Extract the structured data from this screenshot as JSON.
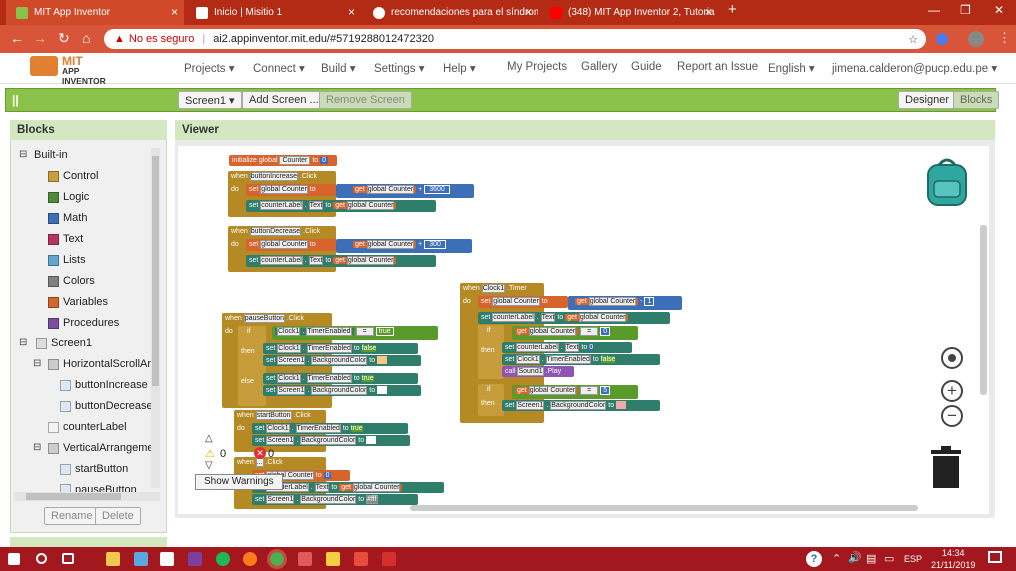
{
  "browser": {
    "tabs": [
      {
        "title": "MIT App Inventor",
        "active": true
      },
      {
        "title": "Inicio | Misitio 1",
        "active": false
      },
      {
        "title": "recomendaciones para el síndrom",
        "active": false
      },
      {
        "title": "(348) MIT App Inventor 2, Tutoria",
        "active": false
      }
    ],
    "new_tab": "+",
    "security": "No es seguro",
    "url": "ai2.appinventor.mit.edu/#5719288012472320"
  },
  "app": {
    "logo_line1": "MIT",
    "logo_line2": "APP INVENTOR",
    "menu": [
      "Projects ▾",
      "Connect ▾",
      "Build ▾",
      "Settings ▾",
      "Help ▾",
      "My Projects",
      "Gallery",
      "Guide",
      "Report an Issue",
      "English ▾",
      "jimena.calderon@pucp.edu.pe ▾"
    ],
    "toolbar": {
      "screen_select": "Screen1 ▾",
      "add_screen": "Add Screen ...",
      "remove_screen": "Remove Screen",
      "designer": "Designer",
      "blocks": "Blocks"
    }
  },
  "blocks_panel": {
    "title": "Blocks",
    "builtin": "Built-in",
    "categories": [
      {
        "name": "Control",
        "color": "#c8a040"
      },
      {
        "name": "Logic",
        "color": "#4f8a3a"
      },
      {
        "name": "Math",
        "color": "#3d6fb8"
      },
      {
        "name": "Text",
        "color": "#b5355d"
      },
      {
        "name": "Lists",
        "color": "#60a8d0"
      },
      {
        "name": "Colors",
        "color": "#808080"
      },
      {
        "name": "Variables",
        "color": "#d7642c"
      },
      {
        "name": "Procedures",
        "color": "#7a4fa0"
      }
    ],
    "screen": "Screen1",
    "components": [
      "HorizontalScrollArr",
      "buttonIncrease",
      "buttonDecrease",
      "counterLabel",
      "VerticalArrangemer",
      "startButton",
      "pauseButton"
    ],
    "rename": "Rename",
    "delete": "Delete"
  },
  "viewer": {
    "title": "Viewer",
    "warnings_count": "0",
    "errors_count": "0",
    "show_warnings": "Show Warnings"
  },
  "blocks": {
    "init": "initialize global",
    "counter_var": "Counter",
    "to": "to",
    "zero": "0",
    "when": "when",
    "do": "do",
    "set": "set",
    "get": "get",
    "global_counter": "global Counter",
    "click": "Click",
    "timer": "Timer",
    "buttonIncrease": "buttonIncrease",
    "buttonDecrease": "buttonDecrease",
    "pauseButton": "pauseButton",
    "startButton": "startButton",
    "clock1": "Clock1",
    "counterLabel": "counterLabel",
    "screen1": "Screen1",
    "text_prop": "Text",
    "bg_prop": "BackgroundColor",
    "timer_enabled": "TimerEnabled",
    "val_3600": "3600",
    "val_300": "300",
    "val_1": "1",
    "val_5": "5",
    "true": "true",
    "false": "false",
    "if": "if",
    "then": "then",
    "else": "else",
    "call": "call",
    "sound1": "Sound1",
    "play": "Play",
    "plus": "+",
    "minus": "-",
    "eq": "=",
    "hex_color": "#fff"
  },
  "taskbar": {
    "lang": "ESP",
    "time": "14:34",
    "date": "21/11/2019"
  }
}
